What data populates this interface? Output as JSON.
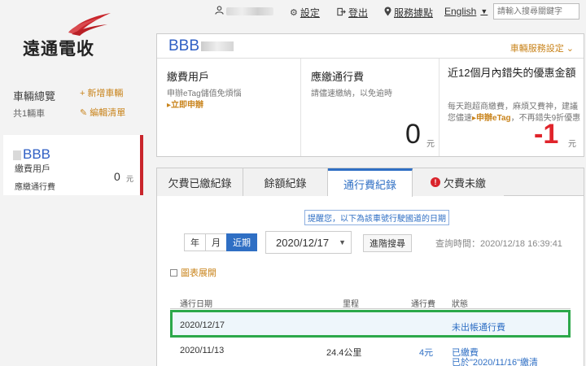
{
  "topbar": {
    "settings_label": "設定",
    "logout_label": "登出",
    "service_label": "服務據點",
    "language_label": "English",
    "search_placeholder": "請輸入搜尋關鍵字"
  },
  "logo": {
    "text": "遠通電收"
  },
  "sidebar": {
    "title": "車輛總覽",
    "count_text": "共1輛車",
    "add_vehicle_label": "新增車輛",
    "edit_list_label": "編輯清單",
    "car": {
      "plate": "BBB",
      "type_label": "繳費用戶",
      "due_label": "應繳通行費",
      "amount": "0",
      "unit": "元"
    }
  },
  "summary": {
    "plate": "BBB",
    "setting_label": "車輛服務設定",
    "col1": {
      "title": "繳費用戶",
      "desc": "申辦eTag儲值免煩惱",
      "link": "▸立即申辦"
    },
    "col2": {
      "title": "應繳通行費",
      "desc": "請儘速繳納，以免逾時",
      "amount": "0",
      "unit": "元"
    },
    "col3": {
      "title": "近12個月內錯失的優惠金額",
      "desc_pre": "每天跑超商繳費，麻煩又費神，建議您儘速",
      "desc_link": "▸申辦eTag",
      "desc_post": "，不再錯失9折優惠",
      "amount": "-1",
      "unit": "元"
    }
  },
  "tabs": [
    {
      "label": "欠費已繳紀錄"
    },
    {
      "label": "餘額紀錄"
    },
    {
      "label": "通行費紀錄"
    },
    {
      "label": "欠費未繳"
    }
  ],
  "records": {
    "notice": "提醒您，以下為該車號行駛國道的日期",
    "period_buttons": [
      "年",
      "月",
      "近期"
    ],
    "selected_date": "2020/12/17",
    "advanced_search_label": "進階搜尋",
    "query_time": "查詢時間：2020/12/18 16:39:41",
    "chart_toggle_label": "圖表展開",
    "columns": [
      "通行日期",
      "里程",
      "通行費",
      "狀態"
    ],
    "rows": [
      {
        "date": "2020/12/17",
        "distance": "",
        "fee": "",
        "status": "未出帳通行費",
        "status2": ""
      },
      {
        "date": "2020/11/13",
        "distance": "24.4公里",
        "fee": "4元",
        "status": "已繳費",
        "status2": "已於\"2020/11/16\"繳清"
      }
    ]
  },
  "colors": {
    "accent_blue": "#2f6fc4",
    "accent_orange": "#c9841c",
    "alert_red": "#e0242b",
    "highlight_green": "#2ca84a"
  }
}
